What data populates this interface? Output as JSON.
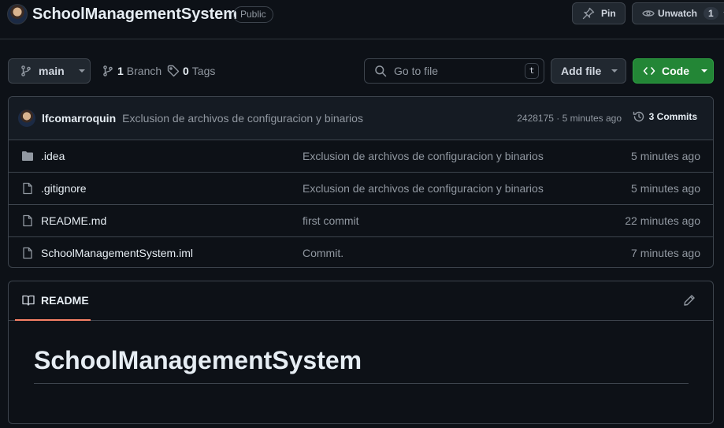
{
  "header": {
    "repo_name": "SchoolManagementSystem",
    "visibility": "Public",
    "pin_label": "Pin",
    "watch_label": "Unwatch",
    "watch_count": "1"
  },
  "toolbar": {
    "branch": "main",
    "branch_count": "1",
    "branch_label": "Branch",
    "tag_count": "0",
    "tag_label": "Tags",
    "goto_placeholder": "Go to file",
    "goto_shortcut": "t",
    "add_file_label": "Add file",
    "code_label": "Code"
  },
  "latest_commit": {
    "author": "lfcomarroquin",
    "message": "Exclusion de archivos de configuracion y binarios",
    "hash_and_time": "2428175 · 5 minutes ago",
    "commits_count_label": "3 Commits"
  },
  "files": [
    {
      "name": ".idea",
      "type": "folder",
      "commit": "Exclusion de archivos de configuracion y binarios",
      "age": "5 minutes ago"
    },
    {
      "name": ".gitignore",
      "type": "file",
      "commit": "Exclusion de archivos de configuracion y binarios",
      "age": "5 minutes ago"
    },
    {
      "name": "README.md",
      "type": "file",
      "commit": "first commit",
      "age": "22 minutes ago"
    },
    {
      "name": "SchoolManagementSystem.iml",
      "type": "file",
      "commit": "Commit.",
      "age": "7 minutes ago"
    }
  ],
  "readme": {
    "tab_label": "README",
    "heading": "SchoolManagementSystem"
  },
  "colors": {
    "background": "#0d1117",
    "code_button": "#238636",
    "tab_underline": "#f78166"
  }
}
